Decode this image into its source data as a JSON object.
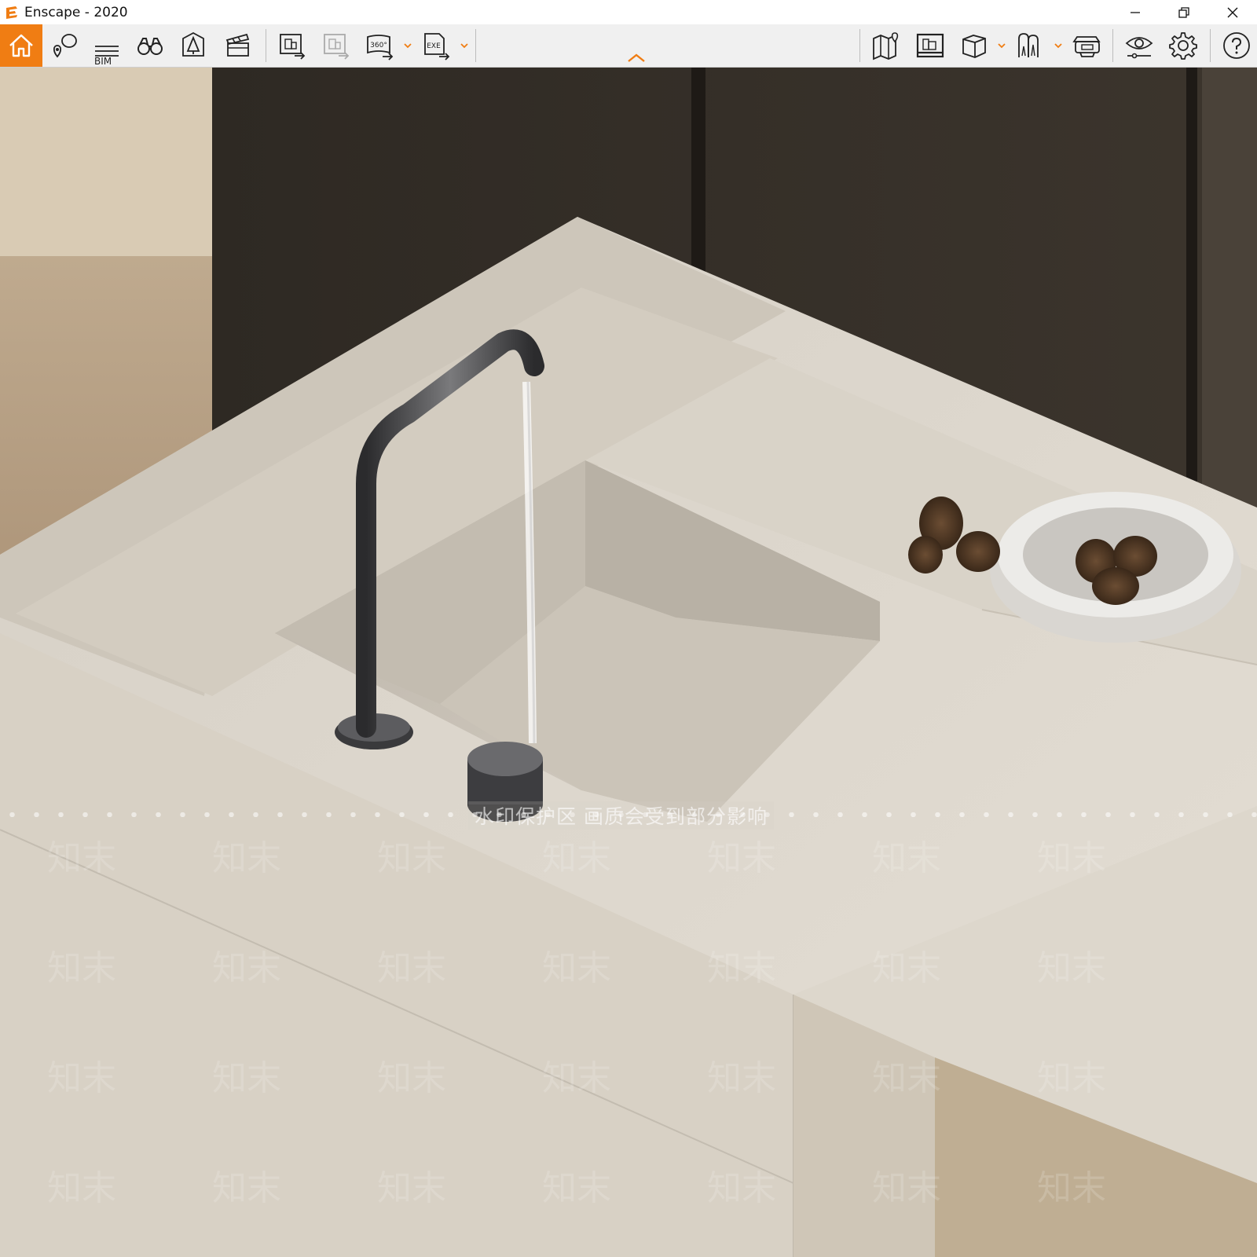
{
  "window": {
    "title": "Enscape - 2020",
    "accent_color": "#f07d13"
  },
  "toolbar": {
    "bim_label": "BIM",
    "left_tools": [
      "home-icon",
      "location-pin-icon",
      "bim-list-icon",
      "binoculars-icon",
      "light-view-icon",
      "video-clapper-icon",
      "export-image-icon",
      "batch-render-icon",
      "panorama-360-icon",
      "exe-export-icon"
    ],
    "panorama_text": "360°",
    "exe_text": "EXE",
    "right_tools": [
      "map-icon",
      "asset-library-icon",
      "box-view-icon",
      "sync-views-icon",
      "vr-headset-icon",
      "visual-settings-icon",
      "gear-icon",
      "help-icon"
    ]
  },
  "viewport": {
    "watermark_text": "水印保护区  画质会受到部分影响",
    "watermark_repeat": "知末"
  }
}
